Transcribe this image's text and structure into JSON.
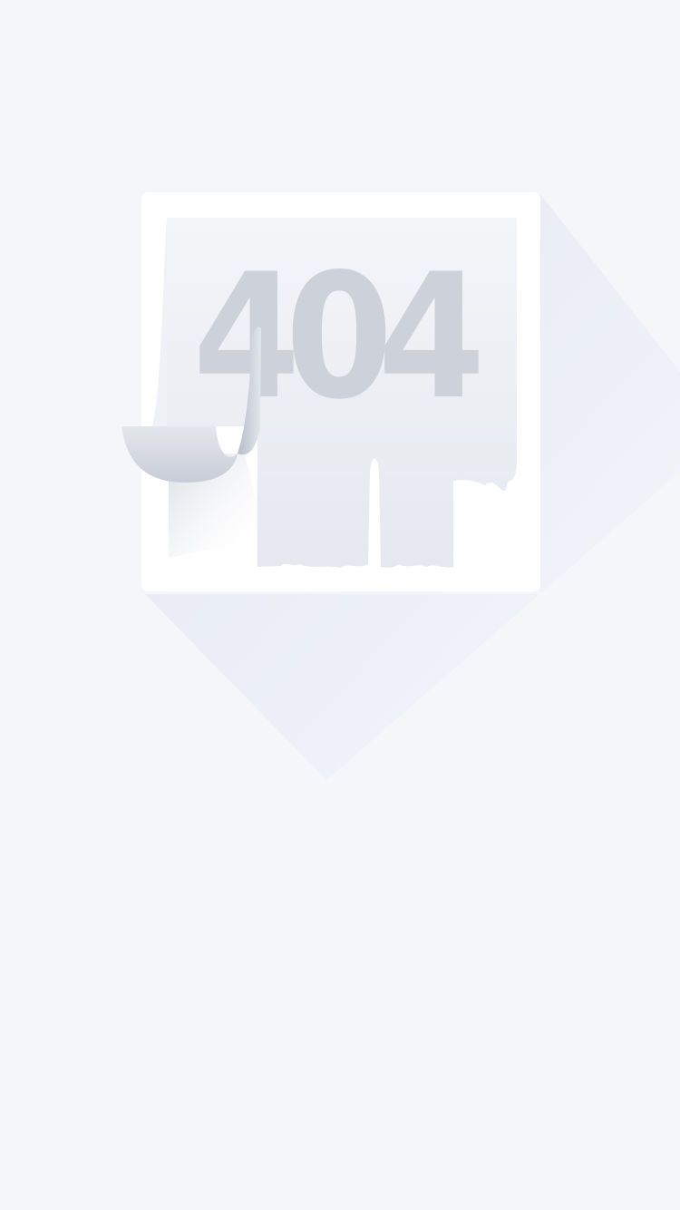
{
  "error": {
    "code_digits": [
      "4",
      "0",
      "4"
    ]
  },
  "colors": {
    "background": "#f4f6fa",
    "frame": "#ffffff",
    "paper_top": "#f3f4f8",
    "paper_bottom": "#e6e9f0",
    "digits": "#cdd1da",
    "curl": "#d6d9e2",
    "shadow": "#e4e7f2"
  }
}
